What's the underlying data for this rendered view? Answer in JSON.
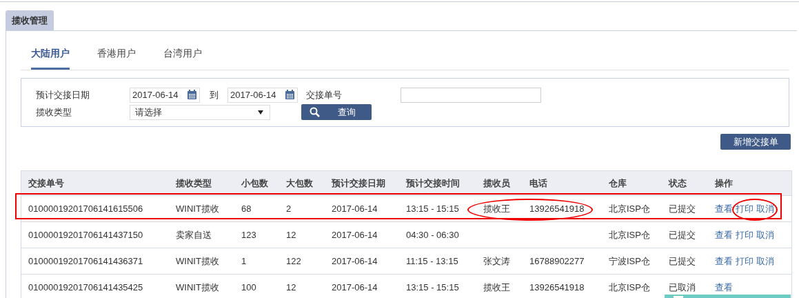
{
  "panel_tab": {
    "label": "揽收管理",
    "selected": true
  },
  "tabs": [
    {
      "label": "大陆用户",
      "selected": true
    },
    {
      "label": "香港用户",
      "selected": false
    },
    {
      "label": "台湾用户",
      "selected": false
    }
  ],
  "filters": {
    "date_label": "预计交接日期",
    "date_from": "2017-06-14",
    "to_label": "到",
    "date_to": "2017-06-14",
    "number_label": "交接单号",
    "type_label": "揽收类型",
    "type_value": "请选择",
    "query_button": "查询"
  },
  "add_button": "新增交接单",
  "table": {
    "columns": [
      "交接单号",
      "揽收类型",
      "小包数",
      "大包数",
      "预计交接日期",
      "预计交接时间",
      "揽收员",
      "电话",
      "仓库",
      "状态",
      "操作"
    ],
    "rows": [
      {
        "number": "01000019201706141615506",
        "type": "WINIT揽收",
        "small": "68",
        "large": "2",
        "date": "2017-06-14",
        "time": "13:15 - 15:15",
        "collector": "揽收王",
        "phone": "13926541918",
        "warehouse": "北京ISP仓",
        "status": "已提交",
        "actions": [
          "查看",
          "打印",
          "取消"
        ],
        "boxed": true,
        "circle_contact": true,
        "circle_actions": true
      },
      {
        "number": "01000019201706141437150",
        "type": "卖家自送",
        "small": "123",
        "large": "12",
        "date": "2017-06-14",
        "time": "04:30 - 06:30",
        "collector": "",
        "phone": "",
        "warehouse": "北京ISP仓",
        "status": "已提交",
        "actions": [
          "查看",
          "打印",
          "取消"
        ],
        "boxed": false,
        "circle_contact": false,
        "circle_actions": false
      },
      {
        "number": "01000019201706141436371",
        "type": "WINIT揽收",
        "small": "1",
        "large": "122",
        "date": "2017-06-14",
        "time": "11:15 - 13:15",
        "collector": "张文涛",
        "phone": "16788902277",
        "warehouse": "宁波ISP仓",
        "status": "已提交",
        "actions": [
          "查看",
          "打印",
          "取消"
        ],
        "boxed": false,
        "circle_contact": false,
        "circle_actions": false
      },
      {
        "number": "01000019201706141435425",
        "type": "WINIT揽收",
        "small": "100",
        "large": "12",
        "date": "2017-06-14",
        "time": "13:15 - 15:15",
        "collector": "揽收王",
        "phone": "13926541918",
        "warehouse": "北京ISP仓",
        "status": "已取消",
        "actions": [
          "查看"
        ],
        "boxed": false,
        "circle_contact": false,
        "circle_actions": false
      }
    ]
  },
  "chat_widget": {
    "visible": true
  }
}
